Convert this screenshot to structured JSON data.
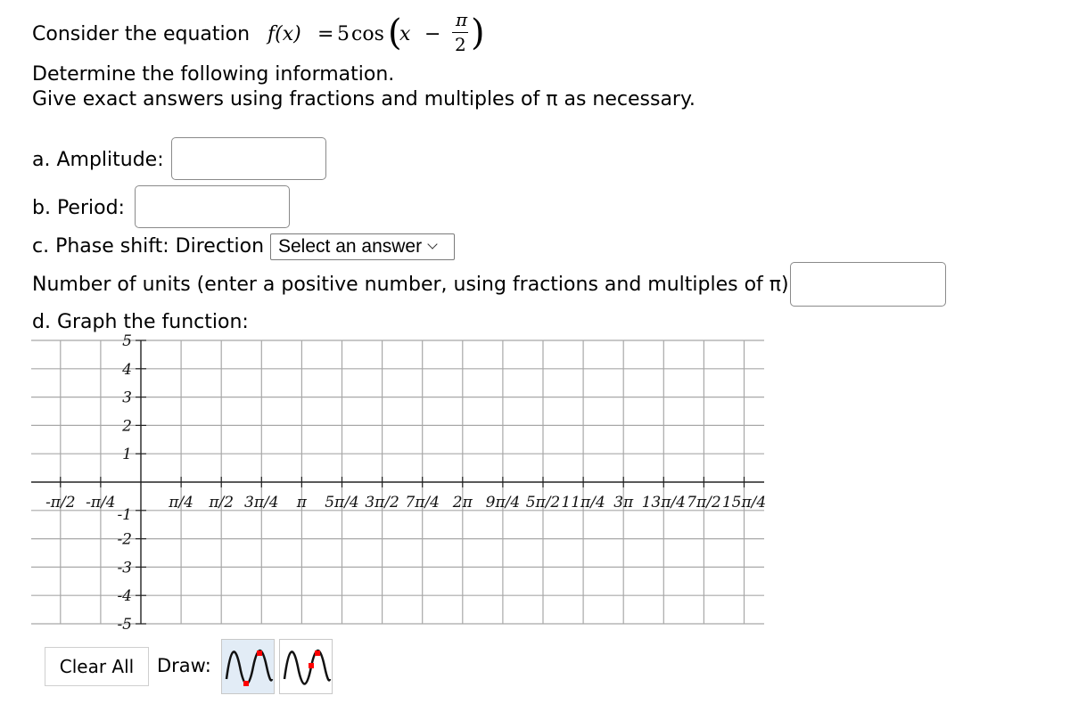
{
  "question": {
    "intro": "Consider the equation",
    "equation": {
      "lhs": "f(x)",
      "equals": "=",
      "coef": "5",
      "func": "cos",
      "var": "x",
      "minus": "−",
      "shift_num": "π",
      "shift_den": "2"
    },
    "line2": "Determine the following information.",
    "line3": "Give exact answers using fractions and multiples of π as necessary."
  },
  "fields": {
    "amplitude": {
      "label": "a. Amplitude:",
      "value": ""
    },
    "period": {
      "label": "b. Period:",
      "value": ""
    },
    "phase_direction": {
      "label": "c. Phase shift: Direction",
      "selected": "Select an answer"
    },
    "units": {
      "label": "Number of units (enter a positive number, using fractions and multiples of π):",
      "value": ""
    }
  },
  "graph": {
    "label": "d. Graph the function:",
    "x_ticks": [
      "-π/2",
      "-π/4",
      "",
      "π/4",
      "π/2",
      "3π/4",
      "π",
      "5π/4",
      "3π/2",
      "7π/4",
      "2π",
      "9π/4",
      "5π/2",
      "11π/4",
      "3π",
      "13π/4",
      "7π/2",
      "15π/4"
    ],
    "y_ticks": [
      "5",
      "4",
      "3",
      "2",
      "1",
      "-1",
      "-2",
      "-3",
      "-4",
      "-5"
    ],
    "x_range_pi_units": [
      -0.5,
      3.75
    ],
    "y_range": [
      -5,
      5
    ]
  },
  "controls": {
    "clear_all": "Clear All",
    "draw_label": "Draw:",
    "tools": [
      {
        "name": "sine-draw-tool",
        "active": true
      },
      {
        "name": "sine-midline-draw-tool",
        "active": false
      }
    ]
  }
}
